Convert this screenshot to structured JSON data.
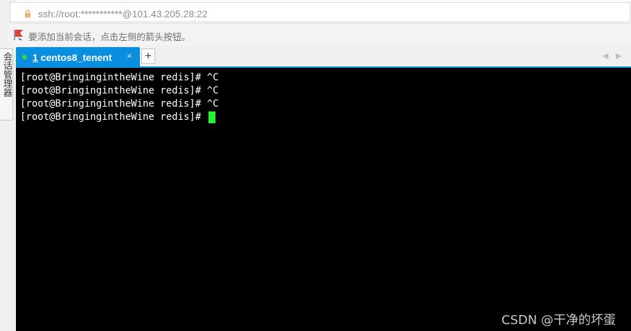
{
  "address": {
    "text": "ssh://root:***********@101.43.205.28:22",
    "icon": "lock-icon"
  },
  "hint": {
    "text": "要添加当前会话，点击左侧的箭头按钮。",
    "icon": "bookmark-icon"
  },
  "side_panel": {
    "label": "会话管理器"
  },
  "tabs": [
    {
      "number": "1",
      "label": " centos8_tenent",
      "status_color": "#3ad24a",
      "close": "×"
    }
  ],
  "tab_add": "+",
  "tab_nav": {
    "prev": "◀",
    "next": "▶"
  },
  "terminal": {
    "lines": [
      "[root@BringingintheWine redis]# ^C",
      "[root@BringingintheWine redis]# ^C",
      "[root@BringingintheWine redis]# ^C",
      "[root@BringingintheWine redis]# "
    ],
    "cursor_color": "#21f32e"
  },
  "watermark": "CSDN @干净的坏蛋",
  "colors": {
    "accent": "#0a8fe0",
    "terminal_bg": "#000000",
    "terminal_fg": "#ffffff"
  }
}
